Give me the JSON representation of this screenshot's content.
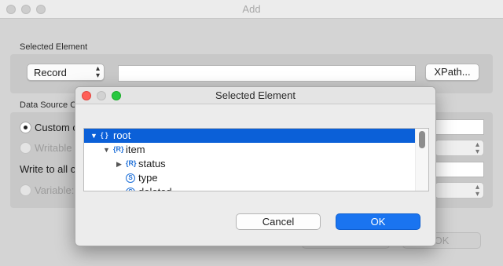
{
  "window": {
    "title": "Add"
  },
  "selected_element_section": {
    "label": "Selected Element",
    "type_select": "Record",
    "path_value": "",
    "xpath_button": "XPath..."
  },
  "data_source_section": {
    "label": "Data Source C",
    "options": [
      {
        "label": "Custom c",
        "selected": true,
        "enabled": true
      },
      {
        "label": "Writable",
        "selected": false,
        "enabled": false
      },
      {
        "label": "Variable:",
        "selected": false,
        "enabled": false
      }
    ],
    "write_to_all_label": "Write to all c"
  },
  "back_ok_button": "OK",
  "modal": {
    "title": "Selected Element",
    "tree": [
      {
        "label": "root",
        "icon": "root",
        "expanded": true,
        "selected": true,
        "indent": 0
      },
      {
        "label": "item",
        "icon": "record",
        "expanded": true,
        "selected": false,
        "indent": 1
      },
      {
        "label": "status",
        "icon": "record",
        "expanded": false,
        "selected": false,
        "indent": 2
      },
      {
        "label": "type",
        "icon": "string",
        "expanded": null,
        "selected": false,
        "indent": 2
      },
      {
        "label": "deleted",
        "icon": "string",
        "expanded": null,
        "selected": false,
        "indent": 2
      }
    ],
    "cancel_button": "Cancel",
    "ok_button": "OK"
  },
  "colors": {
    "accent": "#0b60d8",
    "close": "#ff5f57",
    "minimize": "#d2d2d2",
    "zoom": "#28c840"
  }
}
